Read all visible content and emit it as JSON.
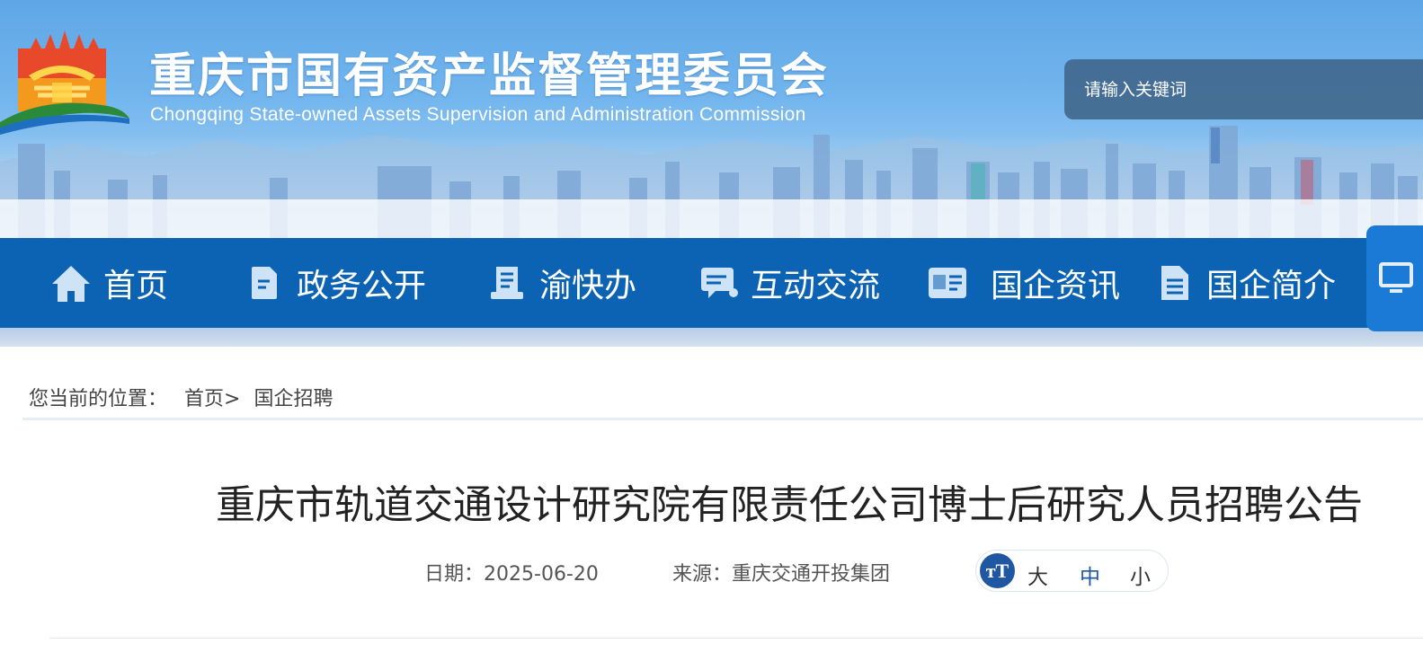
{
  "header": {
    "title": "重庆市国有资产监督管理委员会",
    "subtitle": "Chongqing State-owned Assets Supervision and Administration Commission",
    "search_placeholder": "请输入关键词"
  },
  "nav": {
    "items": [
      {
        "label": "首页",
        "icon": "home-icon"
      },
      {
        "label": "政务公开",
        "icon": "document-icon"
      },
      {
        "label": "渝快办",
        "icon": "reader-icon"
      },
      {
        "label": "互动交流",
        "icon": "chat-icon"
      },
      {
        "label": "国企资讯",
        "icon": "id-card-icon"
      },
      {
        "label": "国企简介",
        "icon": "file-text-icon"
      }
    ],
    "extra_icon": "monitor-icon"
  },
  "breadcrumb": {
    "prefix": "您当前的位置：",
    "home": "首页",
    "separator": ">",
    "current": "国企招聘"
  },
  "article": {
    "title": "重庆市轨道交通设计研究院有限责任公司博士后研究人员招聘公告",
    "date_label": "日期：",
    "date": "2025-06-20",
    "source_label": "来源：",
    "source": "重庆交通开投集团",
    "font_size": {
      "icon": "font-size-icon",
      "icon_text": "тT",
      "large": "大",
      "medium": "中",
      "small": "小"
    }
  },
  "colors": {
    "nav_bg": "#0c63b3",
    "search_bg": "#3c5f82",
    "accent": "#1f57a3"
  }
}
